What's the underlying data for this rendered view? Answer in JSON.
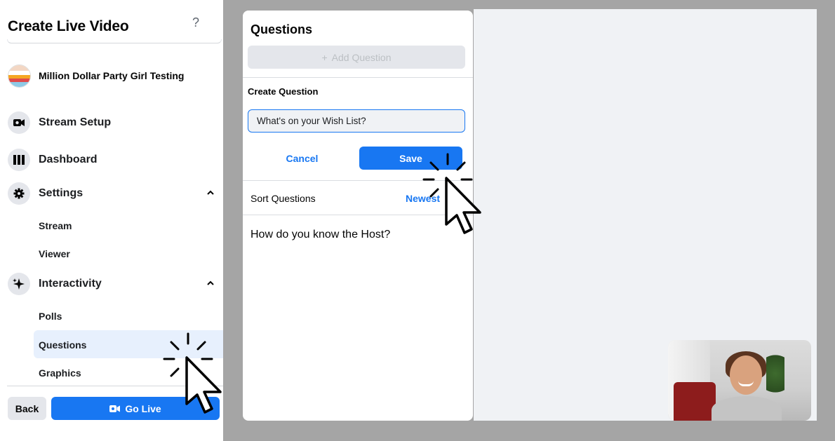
{
  "sidebar": {
    "title": "Create Live Video",
    "help": "?",
    "page_name": "Million Dollar Party Girl Testing",
    "nav": {
      "stream_setup": "Stream Setup",
      "dashboard": "Dashboard",
      "settings": "Settings",
      "interactivity": "Interactivity"
    },
    "settings_sub": {
      "stream": "Stream",
      "viewer": "Viewer"
    },
    "interactivity_sub": {
      "polls": "Polls",
      "questions": "Questions",
      "graphics": "Graphics"
    },
    "back_label": "Back",
    "go_live_label": "Go Live"
  },
  "questions_panel": {
    "title": "Questions",
    "add_question_label": "Add Question",
    "create_question_label": "Create Question",
    "question_input_value": "What's on your Wish List?",
    "cancel_label": "Cancel",
    "save_label": "Save",
    "sort_label": "Sort Questions",
    "sort_value": "Newest",
    "questions": [
      "How do you know the Host?"
    ]
  },
  "colors": {
    "accent": "#1877f2",
    "active_bg": "#e7f0fd",
    "backdrop": "#a5a5a5"
  }
}
